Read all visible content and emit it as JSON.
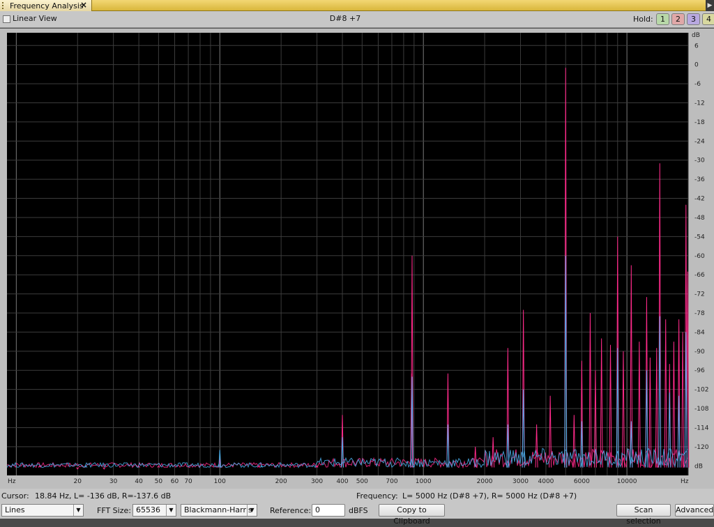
{
  "tab": {
    "title": "Frequency Analysis",
    "close": "×"
  },
  "top": {
    "linear_view_label": "Linear View",
    "linear_view_checked": false,
    "note": "D#8 +7",
    "hold_label": "Hold:",
    "hold_buttons": [
      {
        "label": "1",
        "color": "#b8d8a8"
      },
      {
        "label": "2",
        "color": "#e0a8a8"
      },
      {
        "label": "3",
        "color": "#b8a8e0"
      },
      {
        "label": "4",
        "color": "#d8d8a0"
      }
    ]
  },
  "chart_data": {
    "type": "line",
    "x_scale": "log",
    "xlim": [
      9,
      20000
    ],
    "ylim": [
      -129,
      10
    ],
    "x_unit_left": "Hz",
    "x_unit_right": "Hz",
    "y_unit": "dB",
    "x_ticks": [
      {
        "v": 20,
        "label": "20"
      },
      {
        "v": 30,
        "label": "30"
      },
      {
        "v": 40,
        "label": "40"
      },
      {
        "v": 50,
        "label": "50"
      },
      {
        "v": 60,
        "label": "60"
      },
      {
        "v": 70,
        "label": "70"
      },
      {
        "v": 100,
        "label": "100"
      },
      {
        "v": 200,
        "label": "200"
      },
      {
        "v": 300,
        "label": "300"
      },
      {
        "v": 400,
        "label": "400"
      },
      {
        "v": 500,
        "label": "500"
      },
      {
        "v": 700,
        "label": "700"
      },
      {
        "v": 1000,
        "label": "1000"
      },
      {
        "v": 2000,
        "label": "2000"
      },
      {
        "v": 3000,
        "label": "3000"
      },
      {
        "v": 4000,
        "label": "4000"
      },
      {
        "v": 6000,
        "label": "6000"
      },
      {
        "v": 10000,
        "label": "10000"
      }
    ],
    "y_ticks": [
      6,
      0,
      -6,
      -12,
      -18,
      -24,
      -30,
      -36,
      -42,
      -48,
      -54,
      -60,
      -66,
      -72,
      -78,
      -84,
      -90,
      -96,
      -102,
      -108,
      -114,
      -120
    ],
    "y_bottom_label": "dB",
    "grid": true,
    "background": "#000000",
    "series": [
      {
        "color": "#ff2a8a",
        "peaks": [
          [
            13,
            -126
          ],
          [
            20,
            -127
          ],
          [
            27,
            -127
          ],
          [
            40,
            -126
          ],
          [
            50,
            -126
          ],
          [
            100,
            -124
          ],
          [
            155,
            -126
          ],
          [
            300,
            -126
          ],
          [
            400,
            -110
          ],
          [
            880,
            -60
          ],
          [
            875,
            -97
          ],
          [
            1320,
            -97
          ],
          [
            1800,
            -120
          ],
          [
            2200,
            -117
          ],
          [
            2600,
            -89
          ],
          [
            3100,
            -77
          ],
          [
            3600,
            -113
          ],
          [
            4200,
            -104
          ],
          [
            5000,
            -1
          ],
          [
            5500,
            -110
          ],
          [
            6000,
            -93
          ],
          [
            6600,
            -78
          ],
          [
            7000,
            -96
          ],
          [
            7500,
            -86
          ],
          [
            8300,
            -88
          ],
          [
            9000,
            -54
          ],
          [
            9600,
            -90
          ],
          [
            10500,
            -63
          ],
          [
            11500,
            -87
          ],
          [
            12500,
            -73
          ],
          [
            13000,
            -92
          ],
          [
            14000,
            -89
          ],
          [
            14500,
            -31
          ],
          [
            15500,
            -80
          ],
          [
            16200,
            -94
          ],
          [
            17000,
            -87
          ],
          [
            18000,
            -80
          ],
          [
            18800,
            -84
          ],
          [
            19500,
            -44
          ],
          [
            19900,
            -65
          ]
        ]
      },
      {
        "color": "#4aaeea",
        "peaks": [
          [
            22,
            -126
          ],
          [
            100,
            -121
          ],
          [
            160,
            -126
          ],
          [
            400,
            -117
          ],
          [
            880,
            -98
          ],
          [
            1320,
            -113
          ],
          [
            2600,
            -113
          ],
          [
            3100,
            -102
          ],
          [
            5000,
            -60
          ],
          [
            6000,
            -112
          ],
          [
            9000,
            -89
          ],
          [
            10500,
            -112
          ],
          [
            12500,
            -96
          ],
          [
            14500,
            -79
          ],
          [
            16200,
            -103
          ],
          [
            18000,
            -104
          ],
          [
            19500,
            -84
          ]
        ]
      }
    ]
  },
  "status": {
    "cursor_label": "Cursor:",
    "cursor_value": "18.84 Hz, L= -136 dB, R=-137.6 dB",
    "frequency_label": "Frequency:",
    "frequency_value": "L=  5000 Hz (D#8 +7), R=  5000 Hz (D#8 +7)"
  },
  "controls": {
    "display_mode": "Lines",
    "fft_size_label": "FFT Size:",
    "fft_size": "65536",
    "window": "Blackmann-Harris",
    "reference_label": "Reference:",
    "reference_value": "0",
    "reference_unit": "dBFS",
    "copy_button": "Copy to Clipboard",
    "scan_button": "Scan selection",
    "advanced_button": "Advanced"
  }
}
